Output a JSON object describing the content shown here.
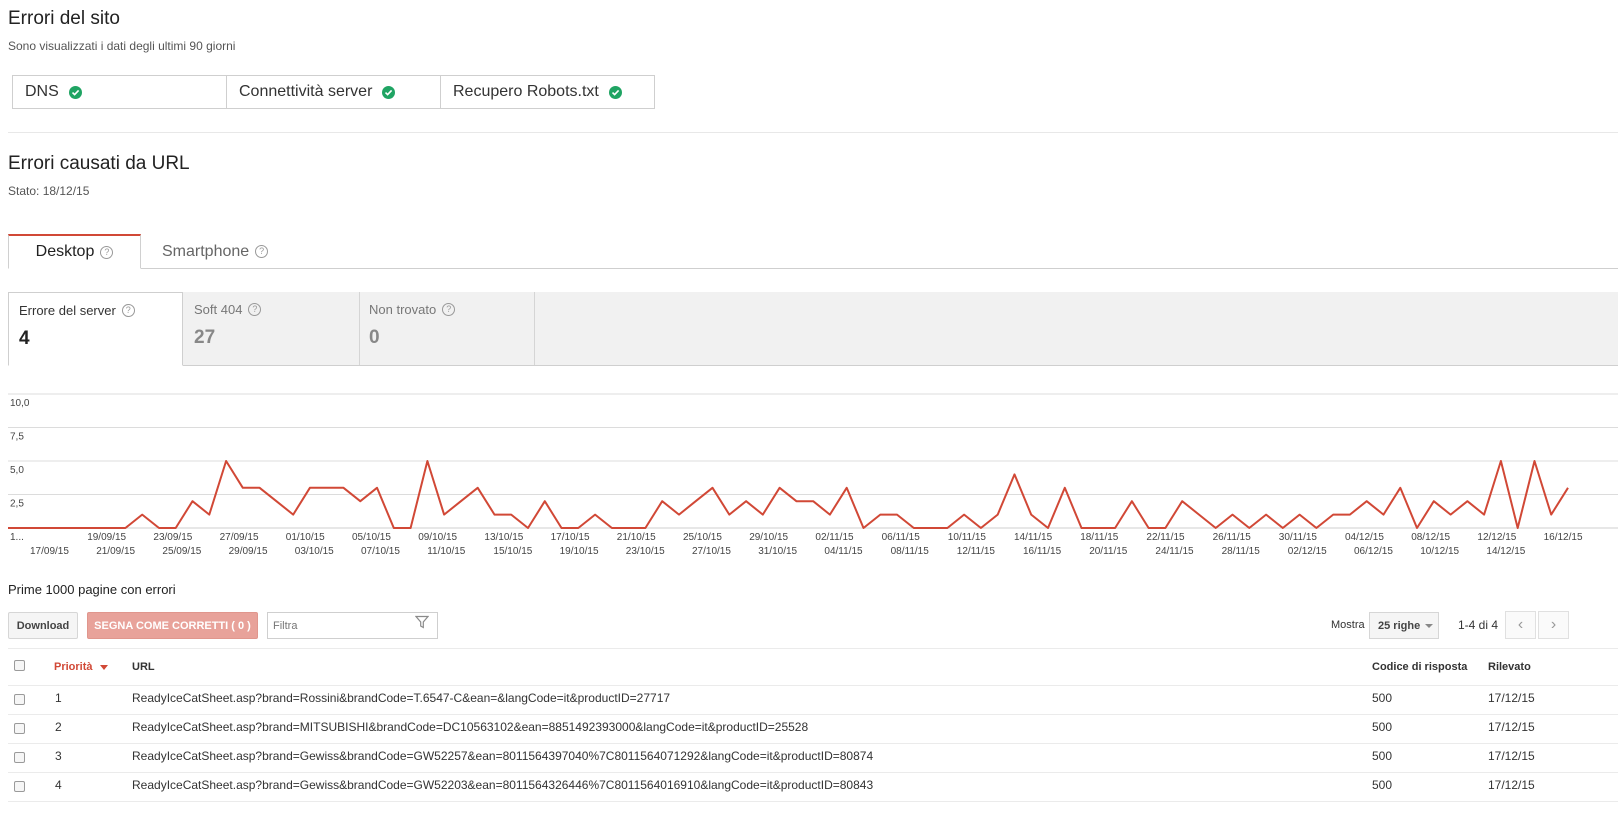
{
  "site_errors": {
    "title": "Errori del sito",
    "subtitle": "Sono visualizzati i dati degli ultimi 90 giorni",
    "items": [
      {
        "label": "DNS",
        "status_icon": "check-circle-icon"
      },
      {
        "label": "Connettività server",
        "status_icon": "check-circle-icon"
      },
      {
        "label": "Recupero Robots.txt",
        "status_icon": "check-circle-icon"
      }
    ],
    "status_color": "#1fa463"
  },
  "url_errors": {
    "title": "Errori causati da URL",
    "status": "Stato:  18/12/15"
  },
  "device_tabs": [
    {
      "label": "Desktop",
      "active": true
    },
    {
      "label": "Smartphone",
      "active": false
    }
  ],
  "categories": [
    {
      "label": "Errore del server",
      "count": "4",
      "active": true
    },
    {
      "label": "Soft 404",
      "count": "27",
      "active": false
    },
    {
      "label": "Non trovato",
      "count": "0",
      "active": false
    }
  ],
  "help_icon": "?",
  "chart_data": {
    "type": "line",
    "color": "#d14836",
    "ylim": [
      0,
      10
    ],
    "yticks": [
      "2,5",
      "5,0",
      "7,5",
      "10,0"
    ],
    "ytick_values": [
      2.5,
      5,
      7.5,
      10
    ],
    "x_labels_top": [
      "1...",
      "19/09/15",
      "23/09/15",
      "27/09/15",
      "01/10/15",
      "05/10/15",
      "09/10/15",
      "13/10/15",
      "17/10/15",
      "21/10/15",
      "25/10/15",
      "29/10/15",
      "02/11/15",
      "06/11/15",
      "10/11/15",
      "14/11/15",
      "18/11/15",
      "22/11/15",
      "26/11/15",
      "30/11/15",
      "04/12/15",
      "08/12/15",
      "12/12/15",
      "16/12/15"
    ],
    "x_labels_bottom": [
      "17/09/15",
      "21/09/15",
      "25/09/15",
      "29/09/15",
      "03/10/15",
      "07/10/15",
      "11/10/15",
      "15/10/15",
      "19/10/15",
      "23/10/15",
      "27/10/15",
      "31/10/15",
      "04/11/15",
      "08/11/15",
      "12/11/15",
      "16/11/15",
      "20/11/15",
      "24/11/15",
      "28/11/15",
      "02/12/15",
      "06/12/15",
      "10/12/15",
      "14/12/15"
    ],
    "values": [
      0,
      0,
      0,
      0,
      0,
      0,
      0,
      0,
      1,
      0,
      0,
      2,
      1,
      5,
      3,
      3,
      2,
      1,
      3,
      3,
      3,
      2,
      3,
      0,
      0,
      5,
      1,
      2,
      3,
      1,
      1,
      0,
      2,
      0,
      0,
      1,
      0,
      0,
      0,
      2,
      1,
      2,
      3,
      1,
      2,
      1,
      3,
      2,
      2,
      1,
      3,
      0,
      1,
      1,
      0,
      0,
      0,
      1,
      0,
      1,
      4,
      1,
      0,
      3,
      0,
      0,
      0,
      2,
      0,
      0,
      2,
      1,
      0,
      1,
      0,
      1,
      0,
      1,
      0,
      1,
      1,
      2,
      1,
      3,
      0,
      2,
      1,
      2,
      1,
      5,
      0,
      5,
      1,
      3
    ]
  },
  "table": {
    "caption": "Prime 1000 pagine con errori",
    "download_label": "Download",
    "mark_fixed_label": "SEGNA COME CORRETTI ( 0 )",
    "filter_placeholder": "Filtra",
    "show_label": "Mostra",
    "rows_select": "25 righe",
    "range": "1-4 di 4",
    "headers": {
      "priority": "Priorità",
      "url": "URL",
      "code": "Codice di risposta",
      "detected": "Rilevato"
    },
    "accent_color": "#d14836",
    "rows": [
      {
        "priority": "1",
        "url": "ReadyIceCatSheet.asp?brand=Rossini&brandCode=T.6547-C&ean=&langCode=it&productID=27717",
        "code": "500",
        "detected": "17/12/15"
      },
      {
        "priority": "2",
        "url": "ReadyIceCatSheet.asp?brand=MITSUBISHI&brandCode=DC10563102&ean=8851492393000&langCode=it&productID=25528",
        "code": "500",
        "detected": "17/12/15"
      },
      {
        "priority": "3",
        "url": "ReadyIceCatSheet.asp?brand=Gewiss&brandCode=GW52257&ean=8011564397040%7C8011564071292&langCode=it&productID=80874",
        "code": "500",
        "detected": "17/12/15"
      },
      {
        "priority": "4",
        "url": "ReadyIceCatSheet.asp?brand=Gewiss&brandCode=GW52203&ean=8011564326446%7C8011564016910&langCode=it&productID=80843",
        "code": "500",
        "detected": "17/12/15"
      }
    ]
  }
}
